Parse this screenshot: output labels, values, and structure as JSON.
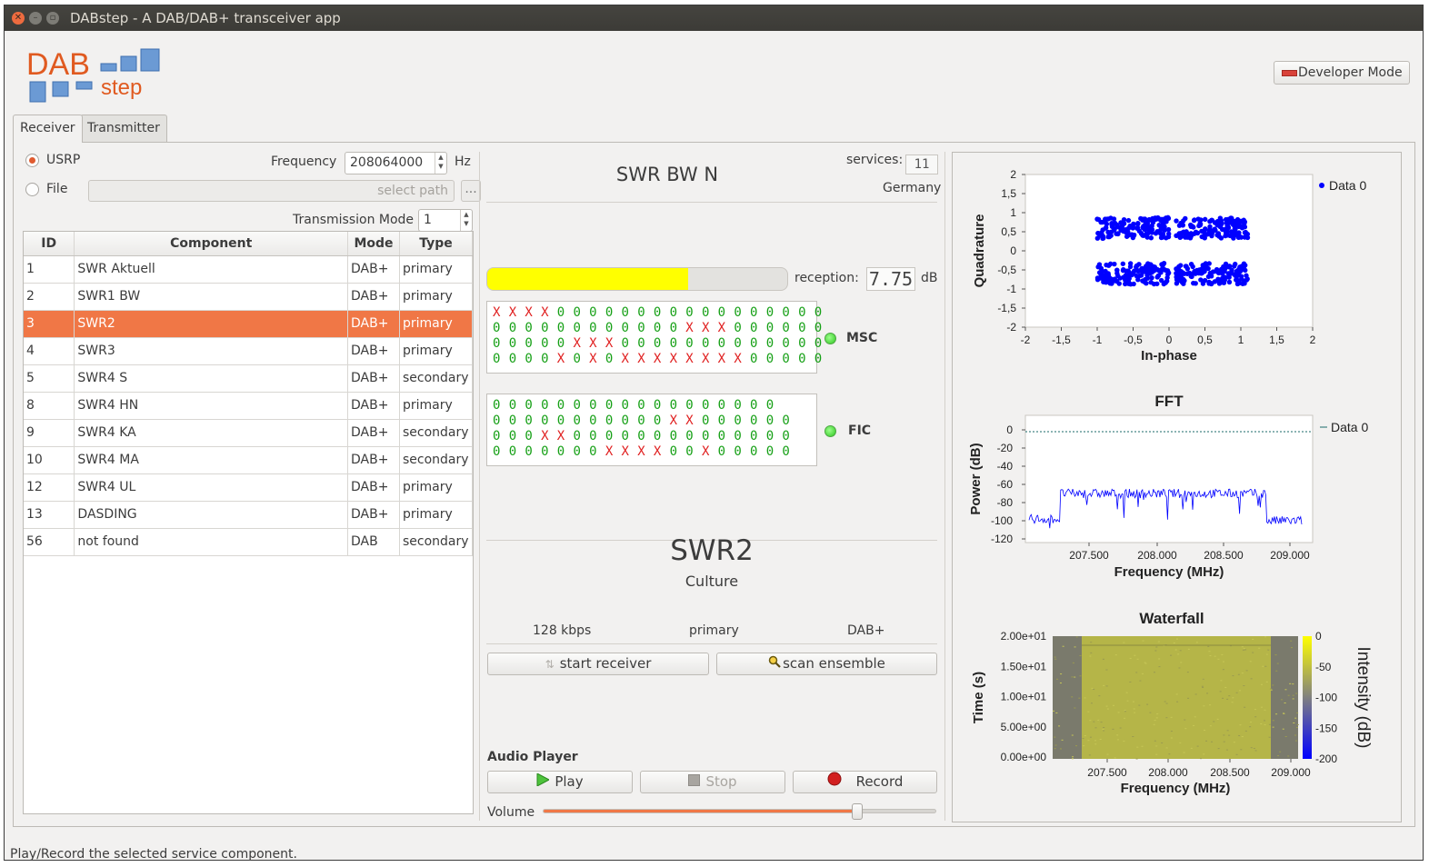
{
  "window": {
    "title": "DABstep - A DAB/DAB+ transceiver app"
  },
  "logo": {
    "line1": "DAB",
    "line2": "step"
  },
  "header": {
    "developer_mode_label": "Developer Mode"
  },
  "tabs": [
    {
      "label": "Receiver",
      "active": true
    },
    {
      "label": "Transmitter",
      "active": false
    }
  ],
  "source": {
    "usrp_label": "USRP",
    "file_label": "File",
    "selected": "USRP",
    "frequency_label": "Frequency",
    "frequency_value": "208064000",
    "frequency_unit": "Hz",
    "file_placeholder": "select path",
    "browse_label": "...",
    "transmission_mode_label": "Transmission Mode",
    "transmission_mode_value": "1"
  },
  "table": {
    "columns": [
      "ID",
      "Component",
      "Mode",
      "Type"
    ],
    "rows": [
      {
        "id": "1",
        "component": "SWR Aktuell",
        "mode": "DAB+",
        "type": "primary"
      },
      {
        "id": "2",
        "component": "SWR1 BW",
        "mode": "DAB+",
        "type": "primary"
      },
      {
        "id": "3",
        "component": "SWR2",
        "mode": "DAB+",
        "type": "primary",
        "selected": true
      },
      {
        "id": "4",
        "component": "SWR3",
        "mode": "DAB+",
        "type": "primary"
      },
      {
        "id": "5",
        "component": "SWR4 S",
        "mode": "DAB+",
        "type": "secondary"
      },
      {
        "id": "8",
        "component": "SWR4 HN",
        "mode": "DAB+",
        "type": "primary"
      },
      {
        "id": "9",
        "component": "SWR4 KA",
        "mode": "DAB+",
        "type": "secondary"
      },
      {
        "id": "10",
        "component": "SWR4 MA",
        "mode": "DAB+",
        "type": "secondary"
      },
      {
        "id": "12",
        "component": "SWR4 UL",
        "mode": "DAB+",
        "type": "primary"
      },
      {
        "id": "13",
        "component": "DASDING",
        "mode": "DAB+",
        "type": "primary"
      },
      {
        "id": "56",
        "component": "not found",
        "mode": "DAB",
        "type": "secondary"
      }
    ]
  },
  "ensemble": {
    "name": "SWR BW N",
    "services_label": "services:",
    "services_value": "11",
    "country": "Germany"
  },
  "reception": {
    "label": "reception:",
    "level": 0.67,
    "value": "7.75",
    "unit": "dB"
  },
  "msc": {
    "label": "MSC",
    "rows": [
      "XXXX00000000000000000",
      "000000000000XXX000000",
      "00000XXX0000000000000",
      "0000X0X0XXXXXXXX00000"
    ]
  },
  "fic": {
    "label": "FIC",
    "rows": [
      "000000000000000000",
      "00000000000XX000000",
      "000XX00000000000000",
      "0000000XXXX00X00000"
    ]
  },
  "service": {
    "name": "SWR2",
    "genre": "Culture",
    "bitrate": "128 kbps",
    "type": "primary",
    "mode": "DAB+"
  },
  "controls": {
    "start_receiver": "start receiver",
    "scan_ensemble": "scan ensemble"
  },
  "audio": {
    "title": "Audio Player",
    "play": "Play",
    "stop": "Stop",
    "record": "Record",
    "volume_label": "Volume",
    "volume": 0.8
  },
  "plots": {
    "constellation": {
      "legend": "Data 0",
      "xlabel": "In-phase",
      "ylabel": "Quadrature",
      "xticks": [
        "-2",
        "-1,5",
        "-1",
        "-0,5",
        "0",
        "0,5",
        "1",
        "1,5",
        "2"
      ],
      "yticks": [
        "2",
        "1,5",
        "1",
        "0,5",
        "0",
        "-0,5",
        "-1",
        "-1,5",
        "-2"
      ],
      "xlim": [
        -2,
        2
      ],
      "ylim": [
        -2,
        2
      ],
      "clusters": [
        [
          -0.5,
          0.6
        ],
        [
          0.6,
          0.6
        ],
        [
          -0.5,
          -0.6
        ],
        [
          0.6,
          -0.6
        ]
      ],
      "color": "#0000ff"
    },
    "fft": {
      "title": "FFT",
      "legend": "Data 0",
      "xlabel": "Frequency (MHz)",
      "ylabel": "Power (dB)",
      "xticks": [
        "207.500",
        "208.000",
        "208.500",
        "209.000"
      ],
      "yticks": [
        "0",
        "-20",
        "-40",
        "-60",
        "-80",
        "-100",
        "-120"
      ],
      "ylim": [
        -120,
        0
      ],
      "color": "#0000ff"
    },
    "waterfall": {
      "title": "Waterfall",
      "xlabel": "Frequency (MHz)",
      "ylabel": "Time (s)",
      "xticks": [
        "207.500",
        "208.000",
        "208.500",
        "209.000"
      ],
      "yticks": [
        "2.00e+01",
        "1.50e+01",
        "1.00e+01",
        "5.00e+00",
        "0.00e+00"
      ],
      "colorbar_label": "Intensity (dB)",
      "colorbar_ticks": [
        "0",
        "-50",
        "-100",
        "-150",
        "-200"
      ]
    }
  },
  "statusbar": {
    "text": "Play/Record the selected service component."
  }
}
